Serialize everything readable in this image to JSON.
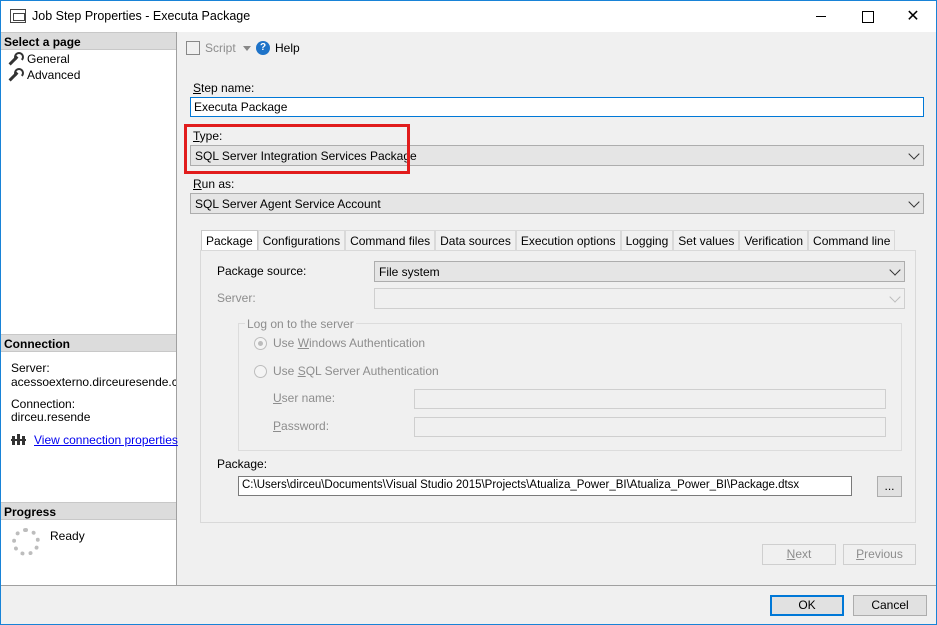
{
  "window": {
    "title": "Job Step Properties - Executa Package"
  },
  "left": {
    "select_page_header": "Select a page",
    "pages": [
      {
        "label": "General"
      },
      {
        "label": "Advanced"
      }
    ],
    "connection_header": "Connection",
    "server_label": "Server:",
    "server_value": "acessoexterno.dirceuresende.com\\",
    "connection_label": "Connection:",
    "connection_value": "dirceu.resende",
    "view_connection_link": "View connection properties",
    "progress_header": "Progress",
    "progress_status": "Ready"
  },
  "toolbar": {
    "script_label": "Script",
    "help_label": "Help"
  },
  "form": {
    "step_name_label_prefix": "",
    "step_name_label_accel": "S",
    "step_name_label_rest": "tep name:",
    "step_name_value": "Executa Package",
    "type_label_accel": "T",
    "type_label_rest": "ype:",
    "type_value": "SQL Server Integration Services Package",
    "run_as_label_accel": "R",
    "run_as_label_rest": "un as:",
    "run_as_value": "SQL Server Agent Service Account"
  },
  "tabs": [
    {
      "label": "Package"
    },
    {
      "label": "Configurations"
    },
    {
      "label": "Command files"
    },
    {
      "label": "Data sources"
    },
    {
      "label": "Execution options"
    },
    {
      "label": "Logging"
    },
    {
      "label": "Set values"
    },
    {
      "label": "Verification"
    },
    {
      "label": "Command line"
    }
  ],
  "package_tab": {
    "package_source_label": "Package source:",
    "package_source_value": "File system",
    "server_label": "Server:",
    "server_value": "",
    "logon_group_label": "Log on to the server",
    "windows_auth_pre": "Use ",
    "windows_auth_accel": "W",
    "windows_auth_rest": "indows Authentication",
    "sql_auth_pre": "Use ",
    "sql_auth_accel": "S",
    "sql_auth_rest": "QL Server Authentication",
    "user_name_label_accel": "U",
    "user_name_label_rest": "ser name:",
    "password_label_accel": "P",
    "password_label_rest": "assword:",
    "package_label": "Package:",
    "package_path": "C:\\Users\\dirceu\\Documents\\Visual Studio 2015\\Projects\\Atualiza_Power_BI\\Atualiza_Power_BI\\Package.dtsx",
    "browse_label": "..."
  },
  "buttons": {
    "next_accel": "N",
    "next_rest": "ext",
    "previous_accel": "P",
    "previous_rest": "revious",
    "ok_label": "OK",
    "cancel_label": "Cancel"
  },
  "colors": {
    "highlight": "#e11c1c",
    "accent": "#0078d7"
  }
}
